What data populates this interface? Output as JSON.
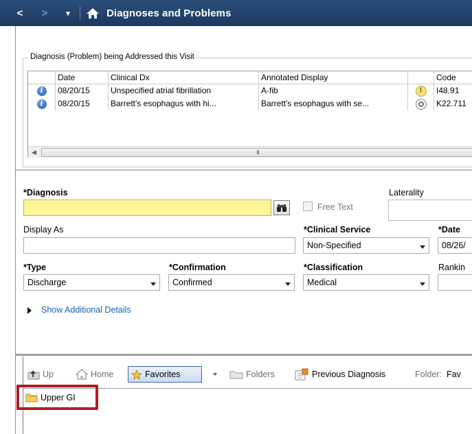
{
  "titlebar": {
    "back": "<",
    "forward": ">",
    "dropdown": "▾",
    "title": "Diagnoses and Problems"
  },
  "diagnosis_list": {
    "group_label": "Diagnosis (Problem) being Addressed this Visit",
    "columns": [
      "",
      "Date",
      "Clinical Dx",
      "Annotated Display",
      "",
      "Code"
    ],
    "rows": [
      {
        "date": "08/20/15",
        "clinical_dx": "Unspecified atrial fibrillation",
        "annotated": "A-fib",
        "status_icon": "warning-icon",
        "code": "I48.91"
      },
      {
        "date": "08/20/15",
        "clinical_dx": "Barrett's esophagus with hi...",
        "annotated": "Barrett's esophagus with se...",
        "status_icon": "radio-icon",
        "code": "K22.711"
      }
    ],
    "scroll_grip": "III"
  },
  "form": {
    "diagnosis_label": "*Diagnosis",
    "diagnosis_value": "",
    "free_text_label": "Free Text",
    "laterality_label": "Laterality",
    "laterality_value": "",
    "display_as_label": "Display As",
    "display_as_value": "",
    "clinical_service_label": "*Clinical Service",
    "clinical_service_value": "Non-Specified",
    "date_label": "*Date",
    "date_value": "08/26/",
    "type_label": "*Type",
    "type_value": "Discharge",
    "confirmation_label": "*Confirmation",
    "confirmation_value": "Confirmed",
    "classification_label": "*Classification",
    "classification_value": "Medical",
    "ranking_label": "Rankin",
    "ranking_value": "",
    "show_details_link": "Show Additional Details"
  },
  "toolbar": {
    "up": "Up",
    "home": "Home",
    "favorites": "Favorites",
    "folders": "Folders",
    "previous_diagnosis": "Previous Diagnosis",
    "folder_label": "Folder:",
    "folder_value": "Fav"
  },
  "folders": {
    "items": [
      "Upper GI"
    ]
  },
  "colors": {
    "titlebar": "#1f3d63",
    "required_field": "#fdf597",
    "link": "#1c5fb4",
    "highlight": "#b01c22"
  }
}
